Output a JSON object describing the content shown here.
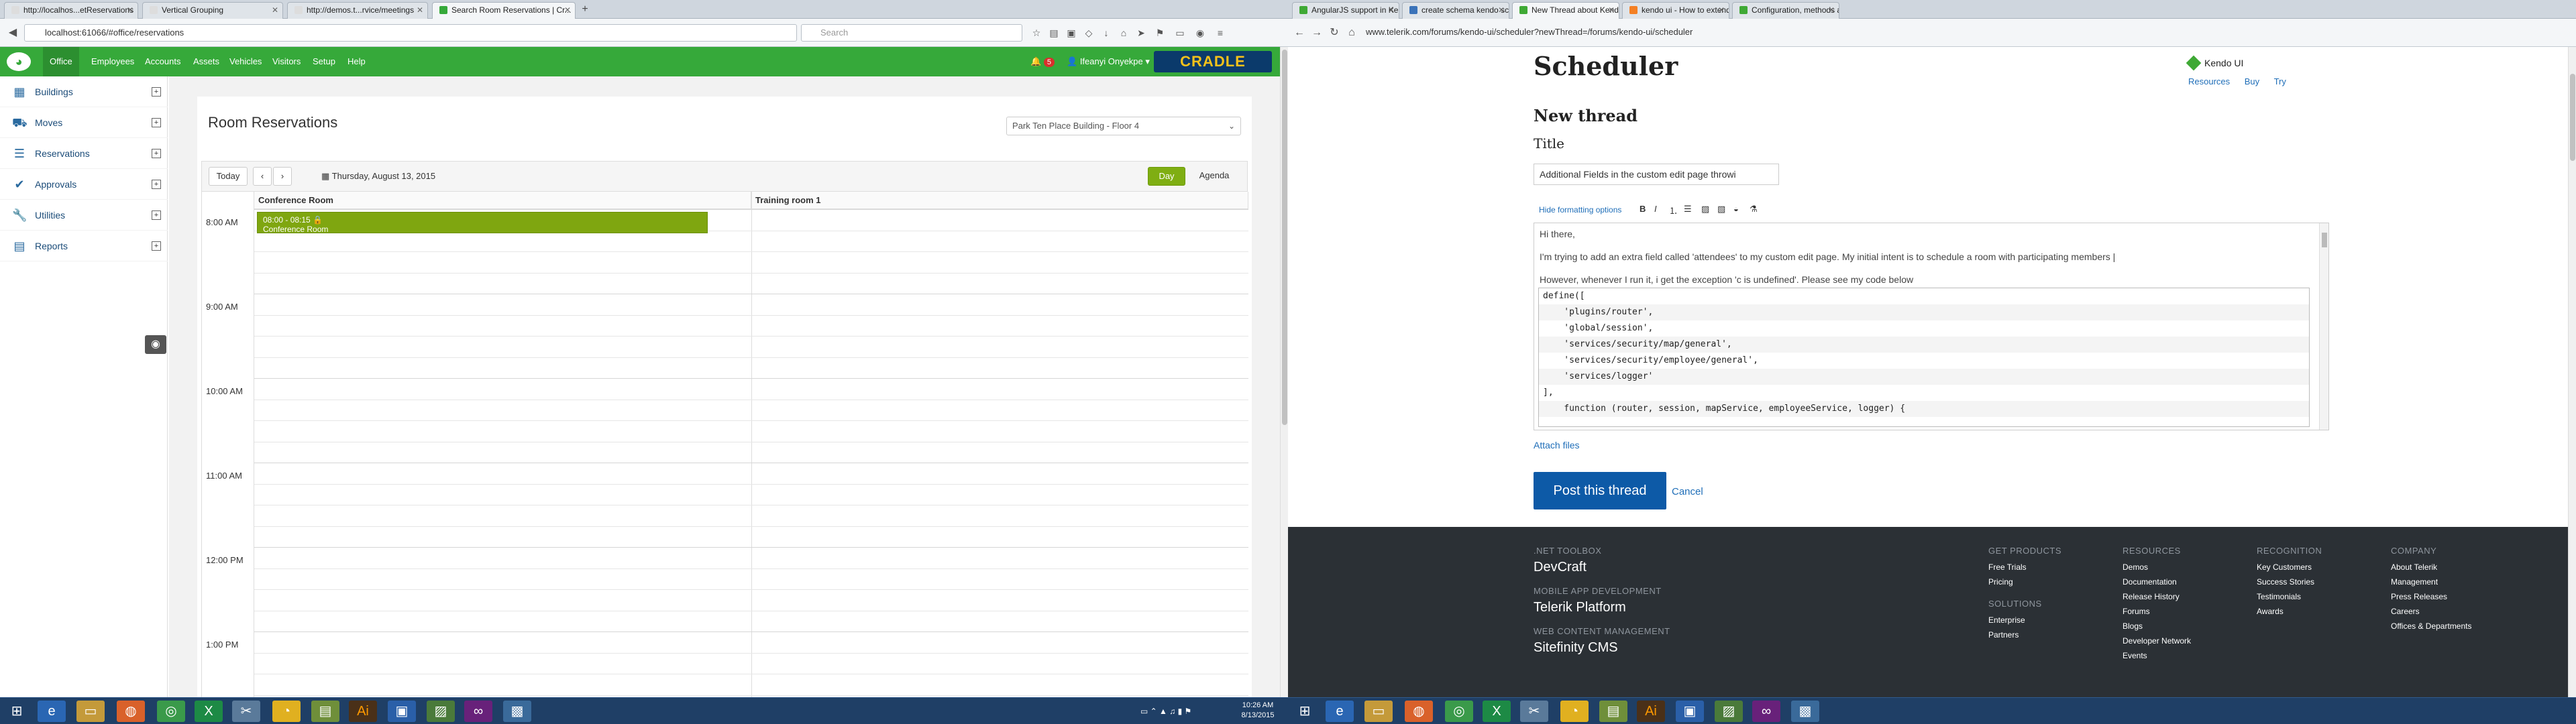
{
  "left": {
    "tabs": [
      {
        "label": "http://localhos...etReservations"
      },
      {
        "label": "Vertical Grouping"
      },
      {
        "label": "http://demos.t...rvice/meetings"
      },
      {
        "label": "Search Room Reservations | Cr..."
      }
    ],
    "url": "localhost:61066/#office/reservations",
    "search_placeholder": "Search",
    "nav_menu": [
      "Office",
      "Employees",
      "Accounts",
      "Assets",
      "Vehicles",
      "Visitors",
      "Setup",
      "Help"
    ],
    "notifications": "5",
    "user": "Ifeanyi Onyekpe",
    "brand": "CRADLE",
    "sidebar": [
      "Buildings",
      "Moves",
      "Reservations",
      "Approvals",
      "Utilities",
      "Reports"
    ],
    "page_title": "Room Reservations",
    "building_select": "Park Ten Place Building - Floor 4",
    "toolbar": {
      "today": "Today",
      "prev": "‹",
      "next": "›",
      "date": "Thursday, August 13, 2015",
      "day": "Day",
      "agenda": "Agenda"
    },
    "rooms": [
      "Conference Room",
      "Training room 1"
    ],
    "times": [
      "8:00 AM",
      "9:00 AM",
      "10:00 AM",
      "11:00 AM",
      "12:00 PM",
      "1:00 PM"
    ],
    "event": {
      "time": "08:00 - 08:15",
      "title": "Conference Room"
    }
  },
  "right": {
    "tabs": [
      {
        "label": "AngularJS support in Kend..."
      },
      {
        "label": "create schema kendo scheduler..."
      },
      {
        "label": "New Thread about Kendo UI..."
      },
      {
        "label": "kendo ui - How to extend..."
      },
      {
        "label": "Configuration, methods and..."
      }
    ],
    "url": "www.telerik.com/forums/kendo-ui/scheduler?newThread=/forums/kendo-ui/scheduler",
    "heading": "Scheduler",
    "product": "Kendo UI",
    "product_links": [
      "Resources",
      "Buy",
      "Try"
    ],
    "subheading": "New thread",
    "title_label": "Title",
    "title_value": "Additional Fields in the custom edit page throwi",
    "hide_formatting": "Hide formatting options",
    "editor_lines": [
      "Hi there,",
      "I'm trying to add an extra field called 'attendees' to my custom edit page. My initial intent is to schedule a room with participating members |",
      "However, whenever I run it, i get the exception 'c is undefined'. Please see my code below"
    ],
    "code_lines": [
      "define([",
      "    'plugins/router',",
      "    'global/session',",
      "    'services/security/map/general',",
      "    'services/security/employee/general',",
      "    'services/logger'",
      "],",
      "    function (router, session, mapService, employeeService, logger) {"
    ],
    "attach": "Attach files",
    "post": "Post this thread",
    "cancel": "Cancel",
    "footer": {
      "net_toolbox": ".NET TOOLBOX",
      "devcraft": "DevCraft",
      "mobile": "MOBILE APP DEVELOPMENT",
      "platform": "Telerik Platform",
      "web": "WEB CONTENT MANAGEMENT",
      "sitefinity": "Sitefinity CMS",
      "cols": [
        {
          "head": "GET PRODUCTS",
          "items": [
            "Free Trials",
            "Pricing"
          ]
        },
        {
          "head": "SOLUTIONS",
          "items": [
            "Enterprise",
            "Partners"
          ]
        },
        {
          "head": "RESOURCES",
          "items": [
            "Demos",
            "Documentation",
            "Release History",
            "Forums",
            "Blogs",
            "Developer Network",
            "Events"
          ]
        },
        {
          "head": "RECOGNITION",
          "items": [
            "Key Customers",
            "Success Stories",
            "Testimonials",
            "Awards"
          ]
        },
        {
          "head": "COMPANY",
          "items": [
            "About Telerik",
            "Management",
            "Press Releases",
            "Careers",
            "Offices & Departments"
          ]
        }
      ]
    }
  },
  "taskbar": {
    "time": "10:26 AM",
    "date": "8/13/2015"
  },
  "colors": {
    "app_green": "#36a93a",
    "event_green": "#7fa610",
    "post_blue": "#0d5aa7",
    "footer": "#2b3035",
    "taskbar": "#1f3f66"
  }
}
